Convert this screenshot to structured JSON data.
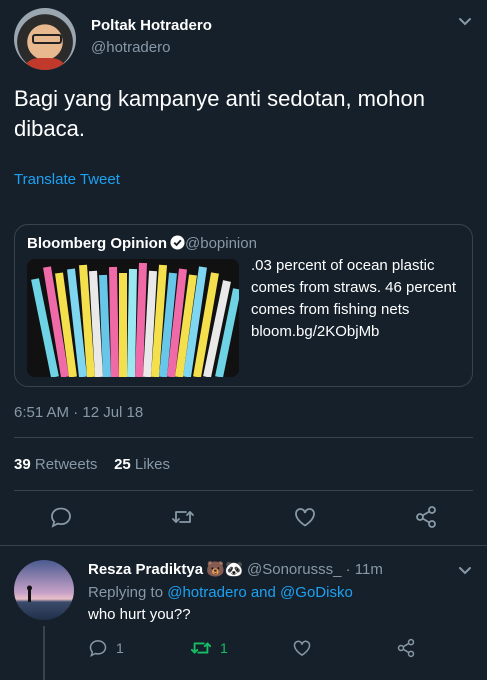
{
  "tweet": {
    "author_name": "Poltak Hotradero",
    "author_handle": "@hotradero",
    "text": "Bagi yang kampanye anti sedotan, mohon dibaca.",
    "translate_label": "Translate Tweet",
    "timestamp": "6:51 AM · 12 Jul 18",
    "retweets_count": "39",
    "retweets_label": "Retweets",
    "likes_count": "25",
    "likes_label": "Likes"
  },
  "quote": {
    "author_name": "Bloomberg Opinion",
    "author_handle": "@bopinion",
    "text": ".03 percent of ocean plastic comes from straws. 46 percent comes from fishing nets bloom.bg/2KObjMb"
  },
  "reply": {
    "author_name": "Resza Pradiktya",
    "author_emoji": "🐻🐼",
    "author_handle": "@Sonorusss_",
    "time": "· 11m",
    "replying_prefix": "Replying to",
    "replying_to_1": "@hotradero",
    "replying_and": "and",
    "replying_to_2": "@GoDisko",
    "text": "who hurt you??",
    "reply_count": "1",
    "retweet_count": "1"
  },
  "colors": {
    "background": "#15202b",
    "accent": "#1da1f2",
    "muted": "#8899a6",
    "retweet_active": "#17bf63",
    "divider": "#38444d"
  },
  "icons": [
    "chevron-down-icon",
    "verified-badge-icon",
    "reply-icon",
    "retweet-icon",
    "like-icon",
    "share-icon"
  ]
}
